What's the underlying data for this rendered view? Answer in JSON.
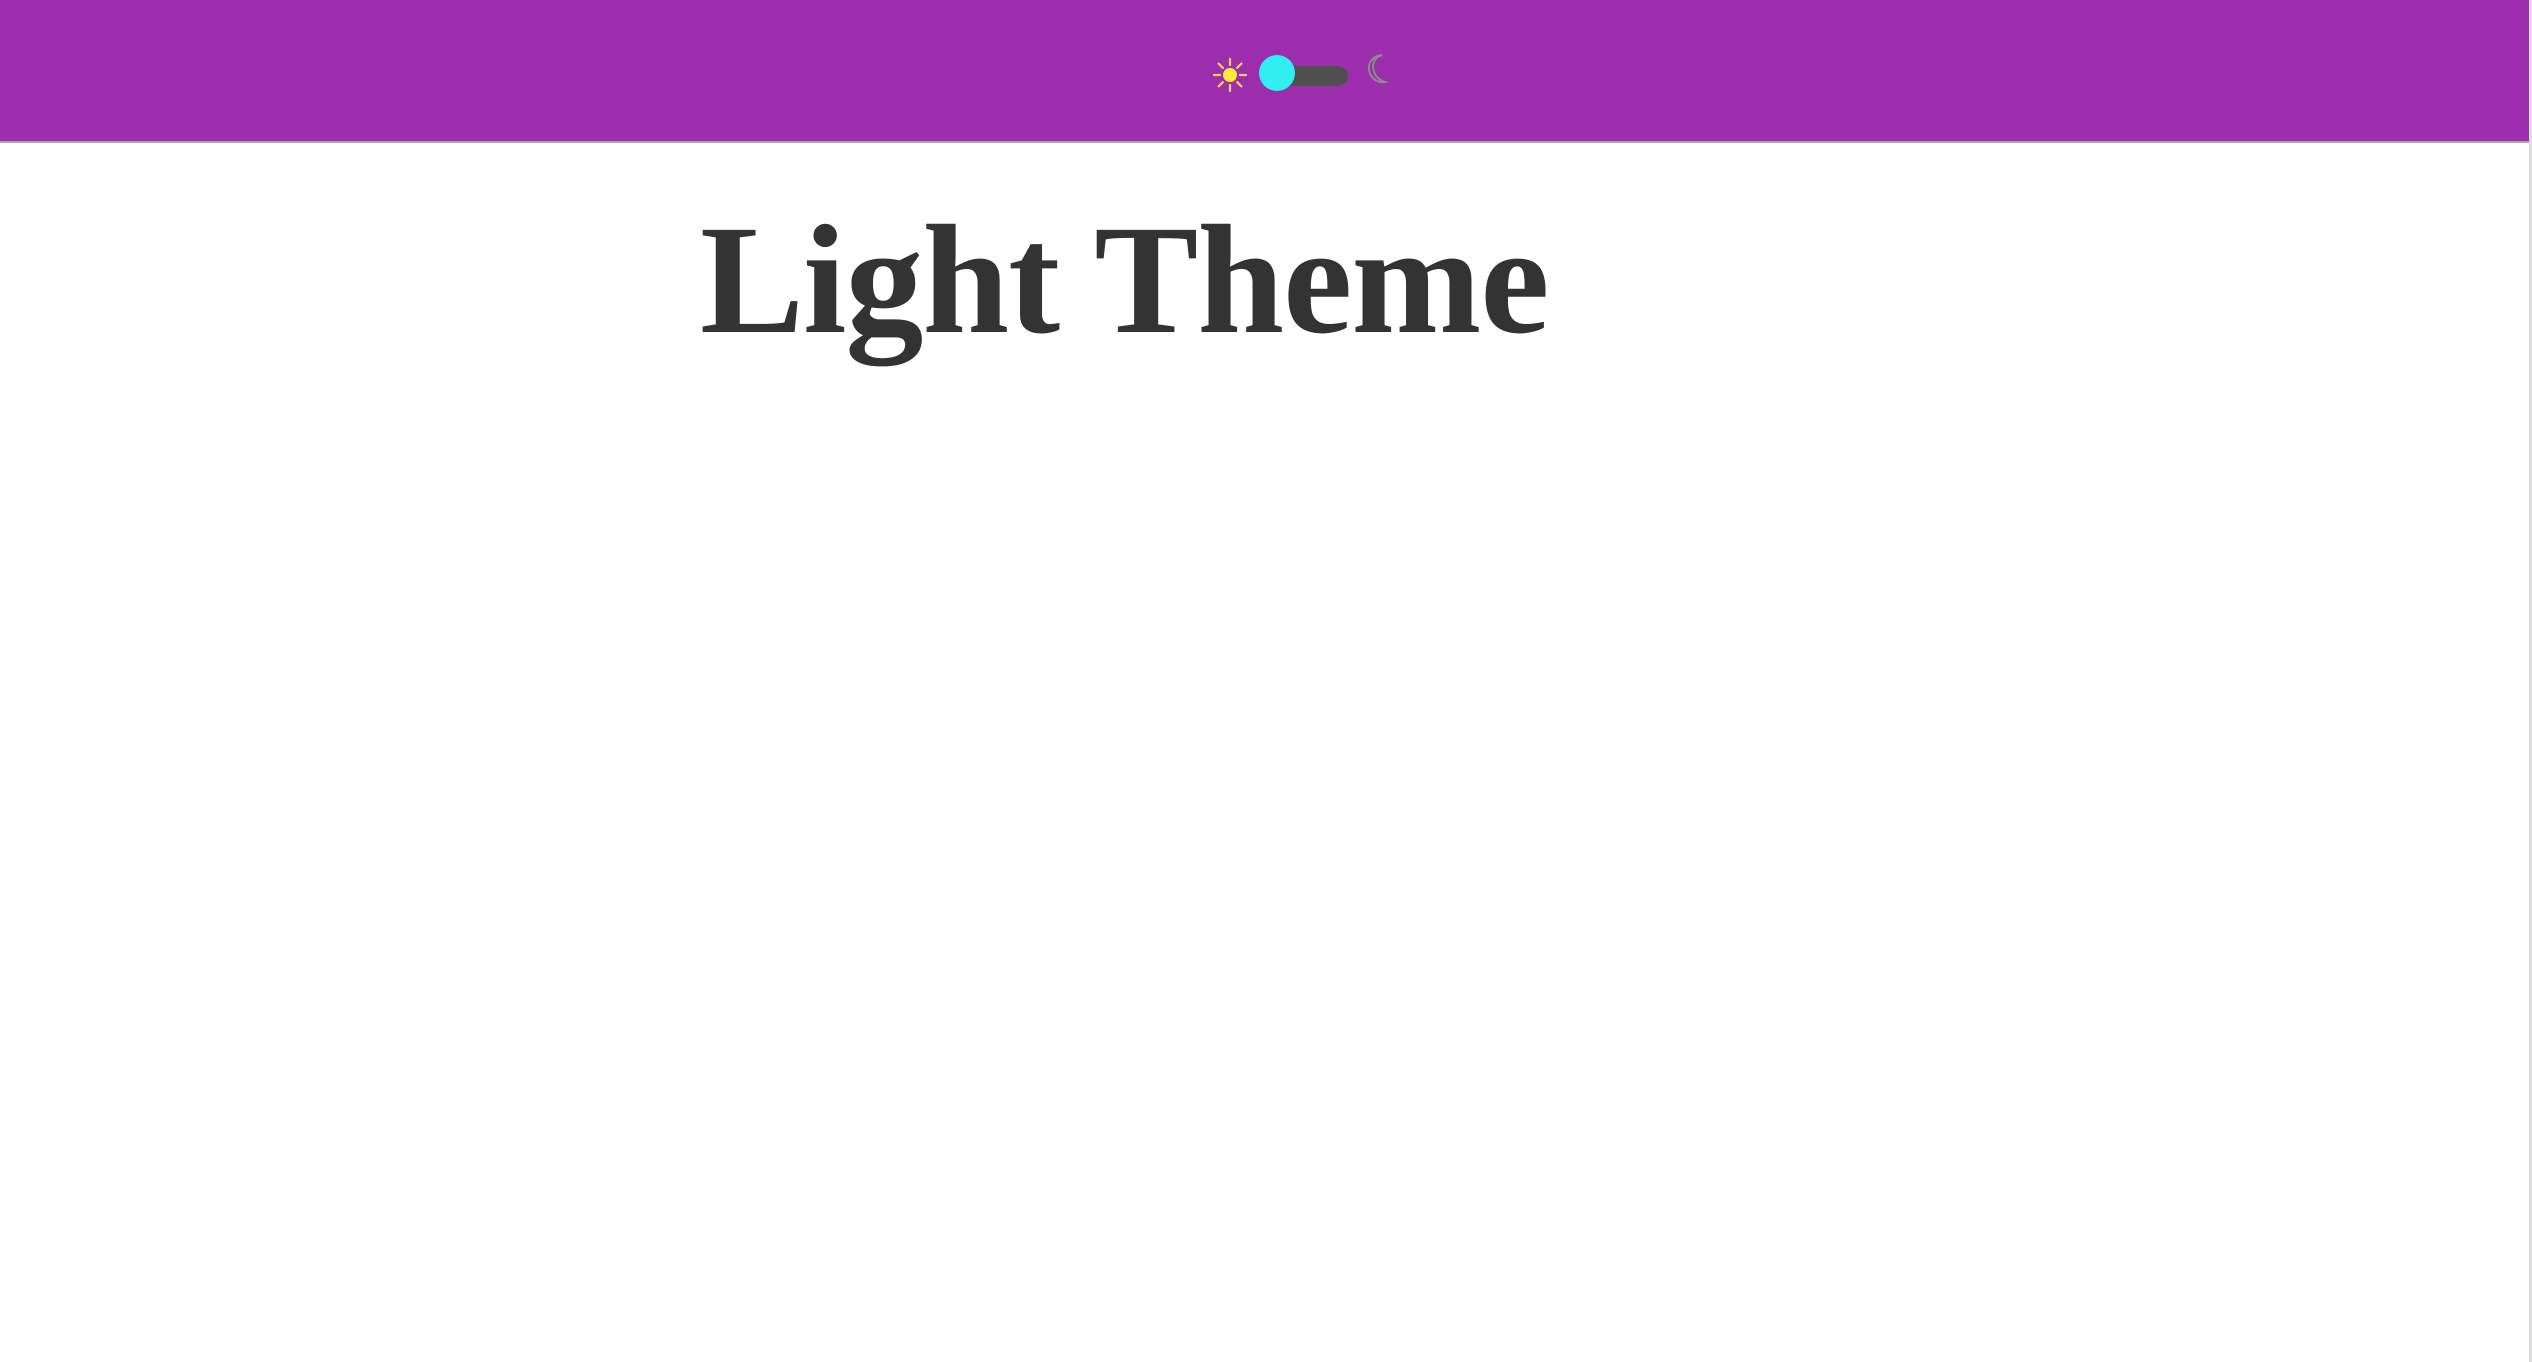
{
  "theme": {
    "mode": "light",
    "colors": {
      "header_bg": "#9c2eae",
      "page_bg": "#ffffff",
      "heading_text": "#333333",
      "switch_knob": "#31eef3",
      "switch_track": "#4f4f4f",
      "sun": "#ffeb3b",
      "moon": "#8b8b8b"
    }
  },
  "header": {
    "theme_toggle": {
      "left_icon": "sun-icon",
      "right_icon": "moon-icon",
      "state": "light"
    }
  },
  "main": {
    "heading": "Light Theme"
  }
}
